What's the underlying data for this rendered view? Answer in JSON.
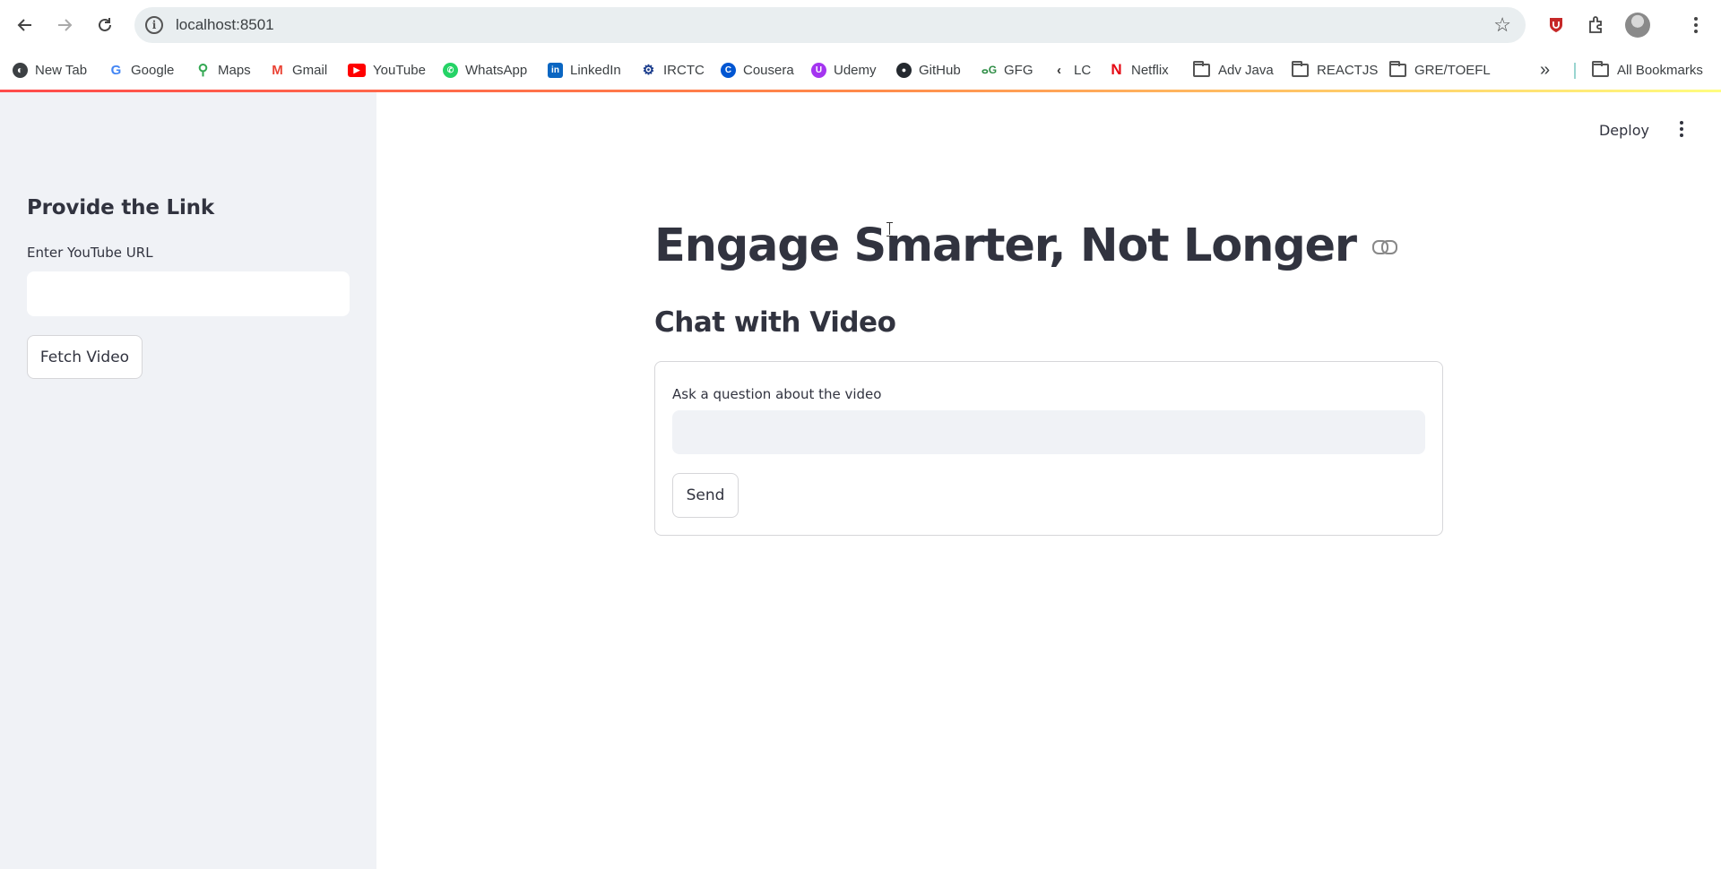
{
  "browser": {
    "url": "localhost:8501",
    "bookmarks": [
      {
        "label": "New Tab",
        "icon": "globe-icon",
        "color": "#3c4043"
      },
      {
        "label": "Google",
        "icon": "google-icon",
        "color": "#4285f4"
      },
      {
        "label": "Maps",
        "icon": "maps-icon",
        "color": "#34a853"
      },
      {
        "label": "Gmail",
        "icon": "gmail-icon",
        "color": "#ea4335"
      },
      {
        "label": "YouTube",
        "icon": "youtube-icon",
        "color": "#ff0000"
      },
      {
        "label": "WhatsApp",
        "icon": "whatsapp-icon",
        "color": "#25d366"
      },
      {
        "label": "LinkedIn",
        "icon": "linkedin-icon",
        "color": "#0a66c2"
      },
      {
        "label": "IRCTC",
        "icon": "irctc-icon",
        "color": "#1a3c8c"
      },
      {
        "label": "Cousera",
        "icon": "coursera-icon",
        "color": "#0056d2"
      },
      {
        "label": "Udemy",
        "icon": "udemy-icon",
        "color": "#a435f0"
      },
      {
        "label": "GitHub",
        "icon": "github-icon",
        "color": "#24292f"
      },
      {
        "label": "GFG",
        "icon": "gfg-icon",
        "color": "#2f8d46"
      },
      {
        "label": "LC",
        "icon": "leetcode-icon",
        "color": "#333333"
      },
      {
        "label": "Netflix",
        "icon": "netflix-icon",
        "color": "#e50914"
      },
      {
        "label": "Adv Java",
        "icon": "folder-icon",
        "color": "#555555"
      },
      {
        "label": "REACTJS",
        "icon": "folder-icon",
        "color": "#555555"
      },
      {
        "label": "GRE/TOEFL",
        "icon": "folder-icon",
        "color": "#555555"
      }
    ],
    "overflow_label": "»",
    "all_bookmarks_label": "All Bookmarks"
  },
  "sidebar": {
    "heading": "Provide the Link",
    "url_label": "Enter YouTube URL",
    "url_value": "",
    "fetch_button": "Fetch Video"
  },
  "header": {
    "deploy_label": "Deploy"
  },
  "main": {
    "title": "Engage Smarter, Not Longer",
    "subtitle": "Chat with Video",
    "question_label": "Ask a question about the video",
    "question_value": "",
    "send_button": "Send"
  },
  "theme": {
    "accent": "#ff4b4b",
    "sidebar_bg": "#f0f2f6",
    "text": "#31333f"
  }
}
